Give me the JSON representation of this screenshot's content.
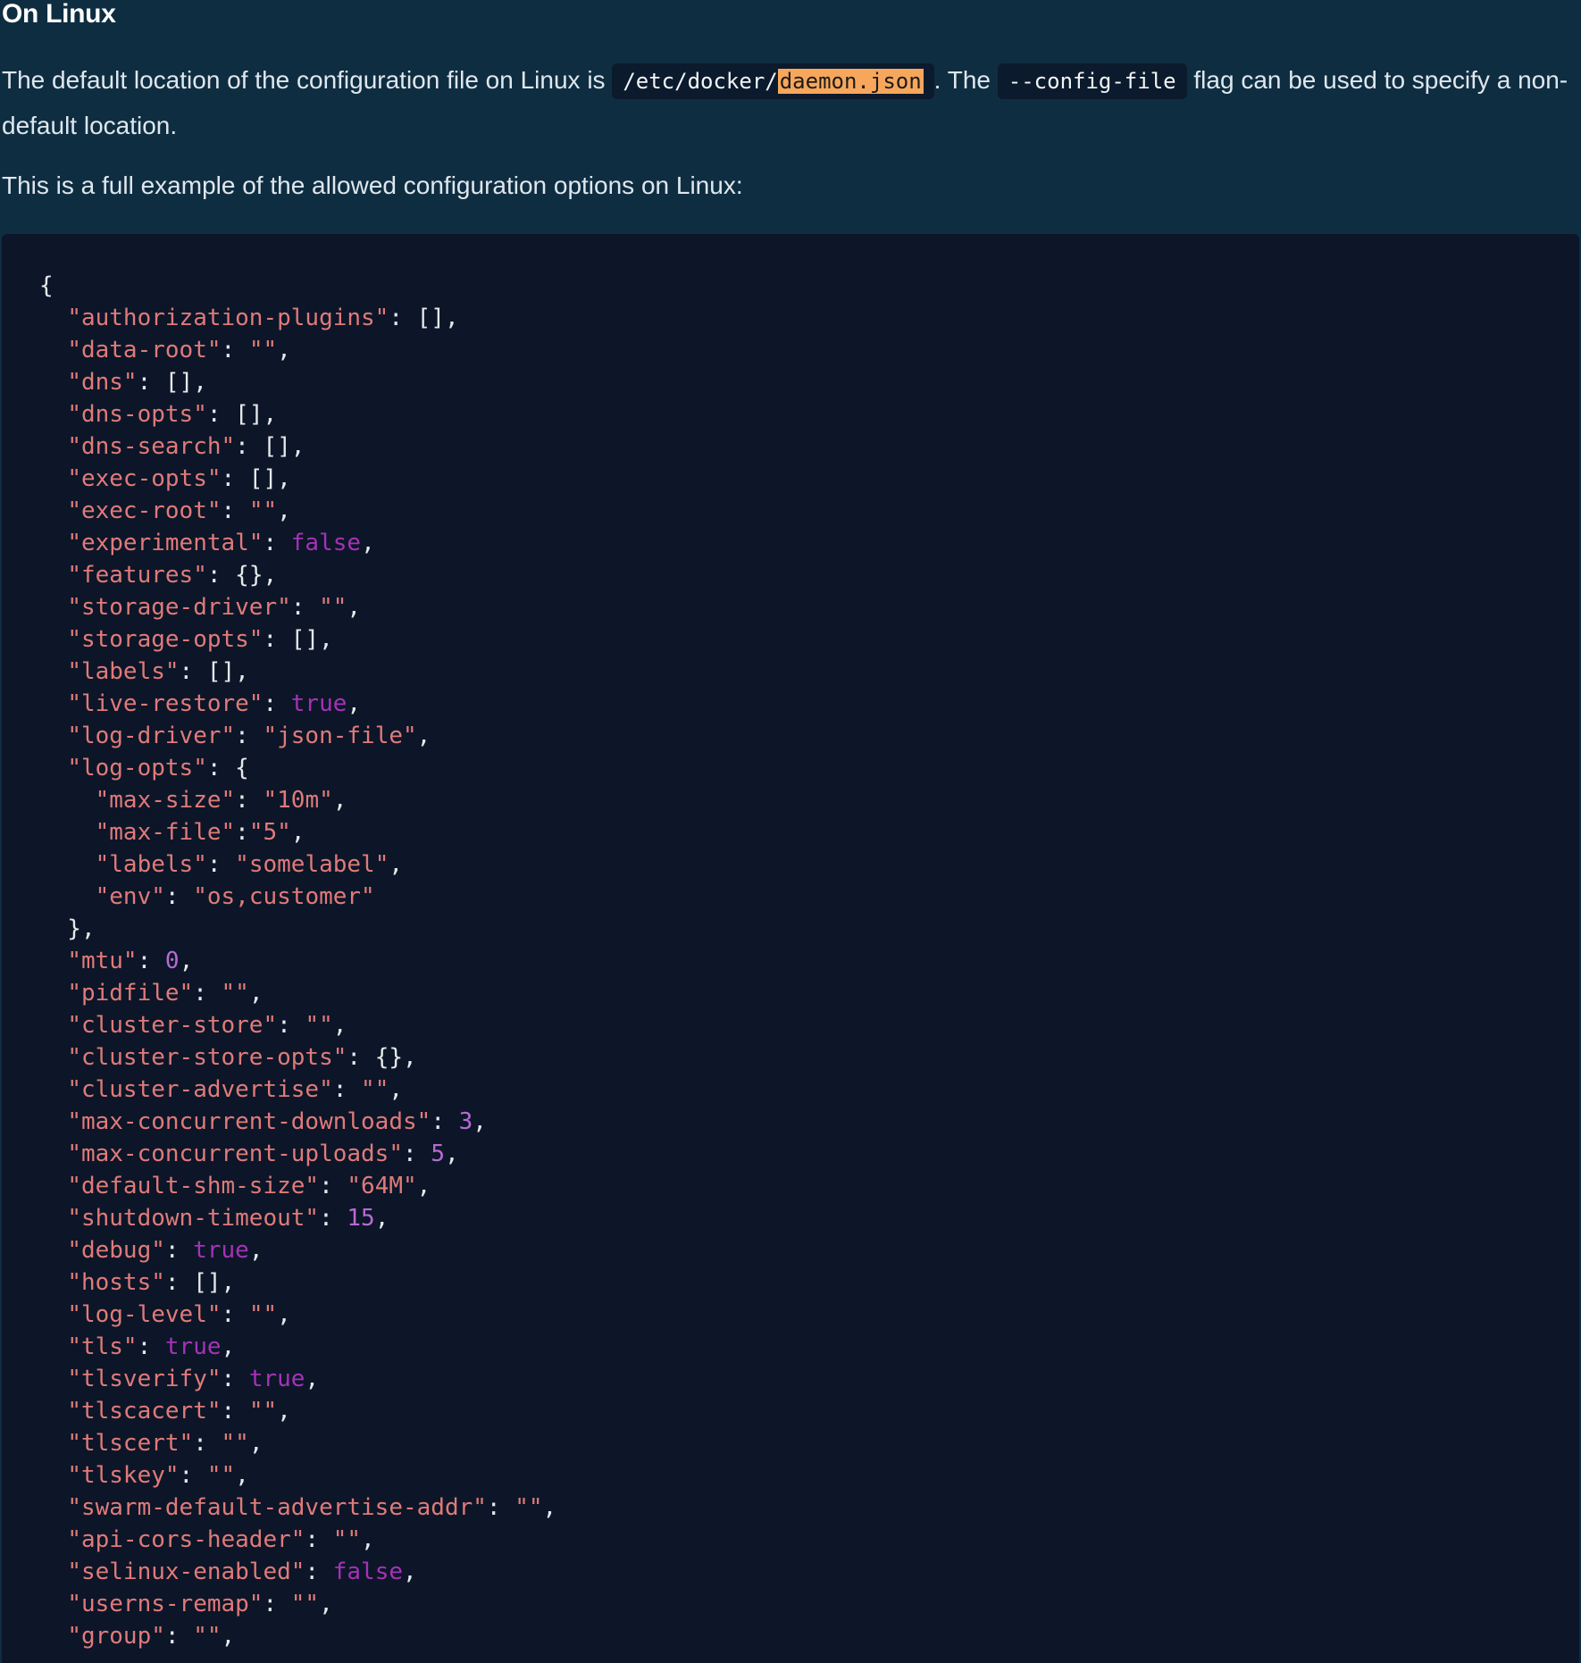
{
  "heading": "On Linux",
  "intro": {
    "before": "The default location of the configuration file on Linux is",
    "path_prefix": "/etc/docker/",
    "path_highlight": "daemon.json",
    "middle": ". The",
    "flag": "--config-file",
    "after": "flag can be used to specify a non-default location."
  },
  "example_intro": "This is a full example of the allowed configuration options on Linux:",
  "colors": {
    "page_background": "#0f2d41",
    "code_background": "#0c1628",
    "string": "#e07a7a",
    "boolean": "#a532b6",
    "number": "#b86ad4",
    "highlight": "#f7a75c"
  },
  "code_lines": [
    [
      {
        "t": "p",
        "v": "{"
      }
    ],
    [
      {
        "t": "p",
        "v": "  "
      },
      {
        "t": "s",
        "v": "\"authorization-plugins\""
      },
      {
        "t": "p",
        "v": ": [],"
      }
    ],
    [
      {
        "t": "p",
        "v": "  "
      },
      {
        "t": "s",
        "v": "\"data-root\""
      },
      {
        "t": "p",
        "v": ": "
      },
      {
        "t": "s",
        "v": "\"\""
      },
      {
        "t": "p",
        "v": ","
      }
    ],
    [
      {
        "t": "p",
        "v": "  "
      },
      {
        "t": "s",
        "v": "\"dns\""
      },
      {
        "t": "p",
        "v": ": [],"
      }
    ],
    [
      {
        "t": "p",
        "v": "  "
      },
      {
        "t": "s",
        "v": "\"dns-opts\""
      },
      {
        "t": "p",
        "v": ": [],"
      }
    ],
    [
      {
        "t": "p",
        "v": "  "
      },
      {
        "t": "s",
        "v": "\"dns-search\""
      },
      {
        "t": "p",
        "v": ": [],"
      }
    ],
    [
      {
        "t": "p",
        "v": "  "
      },
      {
        "t": "s",
        "v": "\"exec-opts\""
      },
      {
        "t": "p",
        "v": ": [],"
      }
    ],
    [
      {
        "t": "p",
        "v": "  "
      },
      {
        "t": "s",
        "v": "\"exec-root\""
      },
      {
        "t": "p",
        "v": ": "
      },
      {
        "t": "s",
        "v": "\"\""
      },
      {
        "t": "p",
        "v": ","
      }
    ],
    [
      {
        "t": "p",
        "v": "  "
      },
      {
        "t": "s",
        "v": "\"experimental\""
      },
      {
        "t": "p",
        "v": ": "
      },
      {
        "t": "b",
        "v": "false"
      },
      {
        "t": "p",
        "v": ","
      }
    ],
    [
      {
        "t": "p",
        "v": "  "
      },
      {
        "t": "s",
        "v": "\"features\""
      },
      {
        "t": "p",
        "v": ": {},"
      }
    ],
    [
      {
        "t": "p",
        "v": "  "
      },
      {
        "t": "s",
        "v": "\"storage-driver\""
      },
      {
        "t": "p",
        "v": ": "
      },
      {
        "t": "s",
        "v": "\"\""
      },
      {
        "t": "p",
        "v": ","
      }
    ],
    [
      {
        "t": "p",
        "v": "  "
      },
      {
        "t": "s",
        "v": "\"storage-opts\""
      },
      {
        "t": "p",
        "v": ": [],"
      }
    ],
    [
      {
        "t": "p",
        "v": "  "
      },
      {
        "t": "s",
        "v": "\"labels\""
      },
      {
        "t": "p",
        "v": ": [],"
      }
    ],
    [
      {
        "t": "p",
        "v": "  "
      },
      {
        "t": "s",
        "v": "\"live-restore\""
      },
      {
        "t": "p",
        "v": ": "
      },
      {
        "t": "b",
        "v": "true"
      },
      {
        "t": "p",
        "v": ","
      }
    ],
    [
      {
        "t": "p",
        "v": "  "
      },
      {
        "t": "s",
        "v": "\"log-driver\""
      },
      {
        "t": "p",
        "v": ": "
      },
      {
        "t": "s",
        "v": "\"json-file\""
      },
      {
        "t": "p",
        "v": ","
      }
    ],
    [
      {
        "t": "p",
        "v": "  "
      },
      {
        "t": "s",
        "v": "\"log-opts\""
      },
      {
        "t": "p",
        "v": ": {"
      }
    ],
    [
      {
        "t": "p",
        "v": "    "
      },
      {
        "t": "s",
        "v": "\"max-size\""
      },
      {
        "t": "p",
        "v": ": "
      },
      {
        "t": "s",
        "v": "\"10m\""
      },
      {
        "t": "p",
        "v": ","
      }
    ],
    [
      {
        "t": "p",
        "v": "    "
      },
      {
        "t": "s",
        "v": "\"max-file\""
      },
      {
        "t": "p",
        "v": ":"
      },
      {
        "t": "s",
        "v": "\"5\""
      },
      {
        "t": "p",
        "v": ","
      }
    ],
    [
      {
        "t": "p",
        "v": "    "
      },
      {
        "t": "s",
        "v": "\"labels\""
      },
      {
        "t": "p",
        "v": ": "
      },
      {
        "t": "s",
        "v": "\"somelabel\""
      },
      {
        "t": "p",
        "v": ","
      }
    ],
    [
      {
        "t": "p",
        "v": "    "
      },
      {
        "t": "s",
        "v": "\"env\""
      },
      {
        "t": "p",
        "v": ": "
      },
      {
        "t": "s",
        "v": "\"os,customer\""
      }
    ],
    [
      {
        "t": "p",
        "v": "  },"
      }
    ],
    [
      {
        "t": "p",
        "v": "  "
      },
      {
        "t": "s",
        "v": "\"mtu\""
      },
      {
        "t": "p",
        "v": ": "
      },
      {
        "t": "n",
        "v": "0"
      },
      {
        "t": "p",
        "v": ","
      }
    ],
    [
      {
        "t": "p",
        "v": "  "
      },
      {
        "t": "s",
        "v": "\"pidfile\""
      },
      {
        "t": "p",
        "v": ": "
      },
      {
        "t": "s",
        "v": "\"\""
      },
      {
        "t": "p",
        "v": ","
      }
    ],
    [
      {
        "t": "p",
        "v": "  "
      },
      {
        "t": "s",
        "v": "\"cluster-store\""
      },
      {
        "t": "p",
        "v": ": "
      },
      {
        "t": "s",
        "v": "\"\""
      },
      {
        "t": "p",
        "v": ","
      }
    ],
    [
      {
        "t": "p",
        "v": "  "
      },
      {
        "t": "s",
        "v": "\"cluster-store-opts\""
      },
      {
        "t": "p",
        "v": ": {},"
      }
    ],
    [
      {
        "t": "p",
        "v": "  "
      },
      {
        "t": "s",
        "v": "\"cluster-advertise\""
      },
      {
        "t": "p",
        "v": ": "
      },
      {
        "t": "s",
        "v": "\"\""
      },
      {
        "t": "p",
        "v": ","
      }
    ],
    [
      {
        "t": "p",
        "v": "  "
      },
      {
        "t": "s",
        "v": "\"max-concurrent-downloads\""
      },
      {
        "t": "p",
        "v": ": "
      },
      {
        "t": "n",
        "v": "3"
      },
      {
        "t": "p",
        "v": ","
      }
    ],
    [
      {
        "t": "p",
        "v": "  "
      },
      {
        "t": "s",
        "v": "\"max-concurrent-uploads\""
      },
      {
        "t": "p",
        "v": ": "
      },
      {
        "t": "n",
        "v": "5"
      },
      {
        "t": "p",
        "v": ","
      }
    ],
    [
      {
        "t": "p",
        "v": "  "
      },
      {
        "t": "s",
        "v": "\"default-shm-size\""
      },
      {
        "t": "p",
        "v": ": "
      },
      {
        "t": "s",
        "v": "\"64M\""
      },
      {
        "t": "p",
        "v": ","
      }
    ],
    [
      {
        "t": "p",
        "v": "  "
      },
      {
        "t": "s",
        "v": "\"shutdown-timeout\""
      },
      {
        "t": "p",
        "v": ": "
      },
      {
        "t": "n",
        "v": "15"
      },
      {
        "t": "p",
        "v": ","
      }
    ],
    [
      {
        "t": "p",
        "v": "  "
      },
      {
        "t": "s",
        "v": "\"debug\""
      },
      {
        "t": "p",
        "v": ": "
      },
      {
        "t": "b",
        "v": "true"
      },
      {
        "t": "p",
        "v": ","
      }
    ],
    [
      {
        "t": "p",
        "v": "  "
      },
      {
        "t": "s",
        "v": "\"hosts\""
      },
      {
        "t": "p",
        "v": ": [],"
      }
    ],
    [
      {
        "t": "p",
        "v": "  "
      },
      {
        "t": "s",
        "v": "\"log-level\""
      },
      {
        "t": "p",
        "v": ": "
      },
      {
        "t": "s",
        "v": "\"\""
      },
      {
        "t": "p",
        "v": ","
      }
    ],
    [
      {
        "t": "p",
        "v": "  "
      },
      {
        "t": "s",
        "v": "\"tls\""
      },
      {
        "t": "p",
        "v": ": "
      },
      {
        "t": "b",
        "v": "true"
      },
      {
        "t": "p",
        "v": ","
      }
    ],
    [
      {
        "t": "p",
        "v": "  "
      },
      {
        "t": "s",
        "v": "\"tlsverify\""
      },
      {
        "t": "p",
        "v": ": "
      },
      {
        "t": "b",
        "v": "true"
      },
      {
        "t": "p",
        "v": ","
      }
    ],
    [
      {
        "t": "p",
        "v": "  "
      },
      {
        "t": "s",
        "v": "\"tlscacert\""
      },
      {
        "t": "p",
        "v": ": "
      },
      {
        "t": "s",
        "v": "\"\""
      },
      {
        "t": "p",
        "v": ","
      }
    ],
    [
      {
        "t": "p",
        "v": "  "
      },
      {
        "t": "s",
        "v": "\"tlscert\""
      },
      {
        "t": "p",
        "v": ": "
      },
      {
        "t": "s",
        "v": "\"\""
      },
      {
        "t": "p",
        "v": ","
      }
    ],
    [
      {
        "t": "p",
        "v": "  "
      },
      {
        "t": "s",
        "v": "\"tlskey\""
      },
      {
        "t": "p",
        "v": ": "
      },
      {
        "t": "s",
        "v": "\"\""
      },
      {
        "t": "p",
        "v": ","
      }
    ],
    [
      {
        "t": "p",
        "v": "  "
      },
      {
        "t": "s",
        "v": "\"swarm-default-advertise-addr\""
      },
      {
        "t": "p",
        "v": ": "
      },
      {
        "t": "s",
        "v": "\"\""
      },
      {
        "t": "p",
        "v": ","
      }
    ],
    [
      {
        "t": "p",
        "v": "  "
      },
      {
        "t": "s",
        "v": "\"api-cors-header\""
      },
      {
        "t": "p",
        "v": ": "
      },
      {
        "t": "s",
        "v": "\"\""
      },
      {
        "t": "p",
        "v": ","
      }
    ],
    [
      {
        "t": "p",
        "v": "  "
      },
      {
        "t": "s",
        "v": "\"selinux-enabled\""
      },
      {
        "t": "p",
        "v": ": "
      },
      {
        "t": "b",
        "v": "false"
      },
      {
        "t": "p",
        "v": ","
      }
    ],
    [
      {
        "t": "p",
        "v": "  "
      },
      {
        "t": "s",
        "v": "\"userns-remap\""
      },
      {
        "t": "p",
        "v": ": "
      },
      {
        "t": "s",
        "v": "\"\""
      },
      {
        "t": "p",
        "v": ","
      }
    ],
    [
      {
        "t": "p",
        "v": "  "
      },
      {
        "t": "s",
        "v": "\"group\""
      },
      {
        "t": "p",
        "v": ": "
      },
      {
        "t": "s",
        "v": "\"\""
      },
      {
        "t": "p",
        "v": ","
      }
    ]
  ]
}
